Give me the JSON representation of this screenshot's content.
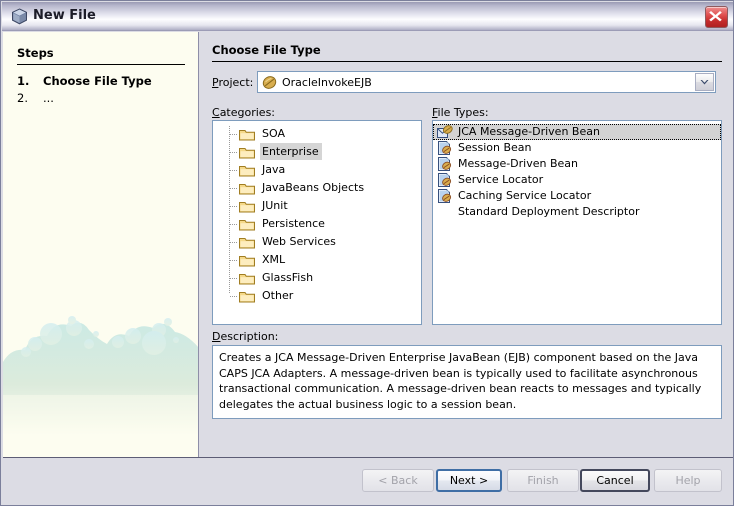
{
  "window": {
    "title": "New File",
    "title_icon": "cube-icon",
    "close_label": "×",
    "accent_border": "#7e9cbd",
    "chrome_bg": "#dcdce4",
    "steps_bg": "#fdfdf0"
  },
  "steps": {
    "heading": "Steps",
    "items": [
      {
        "number": "1.",
        "label": "Choose File Type",
        "state": "current"
      },
      {
        "number": "2.",
        "label": "...",
        "state": "pending"
      }
    ]
  },
  "content": {
    "heading": "Choose File Type",
    "project": {
      "label": "Project:",
      "value": "OracleInvokeEJB",
      "icon": "coffee-bean-icon",
      "arrow_icon": "chevron-down-icon"
    },
    "categories": {
      "label": "Categories:",
      "selected_index": 1,
      "items": [
        "SOA",
        "Enterprise",
        "Java",
        "JavaBeans Objects",
        "JUnit",
        "Persistence",
        "Web Services",
        "XML",
        "GlassFish",
        "Other"
      ]
    },
    "file_types": {
      "label": "File Types:",
      "selected_index": 0,
      "items": [
        {
          "label": "JCA Message-Driven Bean",
          "icon": "envelope-bean-icon"
        },
        {
          "label": "Session Bean",
          "icon": "bean-document-icon"
        },
        {
          "label": "Message-Driven Bean",
          "icon": "bean-document-icon"
        },
        {
          "label": "Service Locator",
          "icon": "bean-document-icon"
        },
        {
          "label": "Caching Service Locator",
          "icon": "bean-document-icon"
        },
        {
          "label": "Standard Deployment Descriptor",
          "icon": "none"
        }
      ]
    },
    "description": {
      "label": "Description:",
      "text": "Creates a JCA Message-Driven Enterprise JavaBean (EJB) component based on the Java CAPS JCA Adapters. A message-driven bean is typically used to facilitate asynchronous transactional communication. A message-driven bean reacts to messages and typically delegates the actual business logic to a session bean."
    }
  },
  "footer": {
    "buttons": [
      {
        "id": "back",
        "label": "< Back",
        "state": "disabled"
      },
      {
        "id": "next",
        "label": "Next >",
        "state": "default"
      },
      {
        "id": "finish",
        "label": "Finish",
        "state": "disabled"
      },
      {
        "id": "cancel",
        "label": "Cancel",
        "state": "strong"
      },
      {
        "id": "help",
        "label": "Help",
        "state": "disabled"
      }
    ]
  }
}
